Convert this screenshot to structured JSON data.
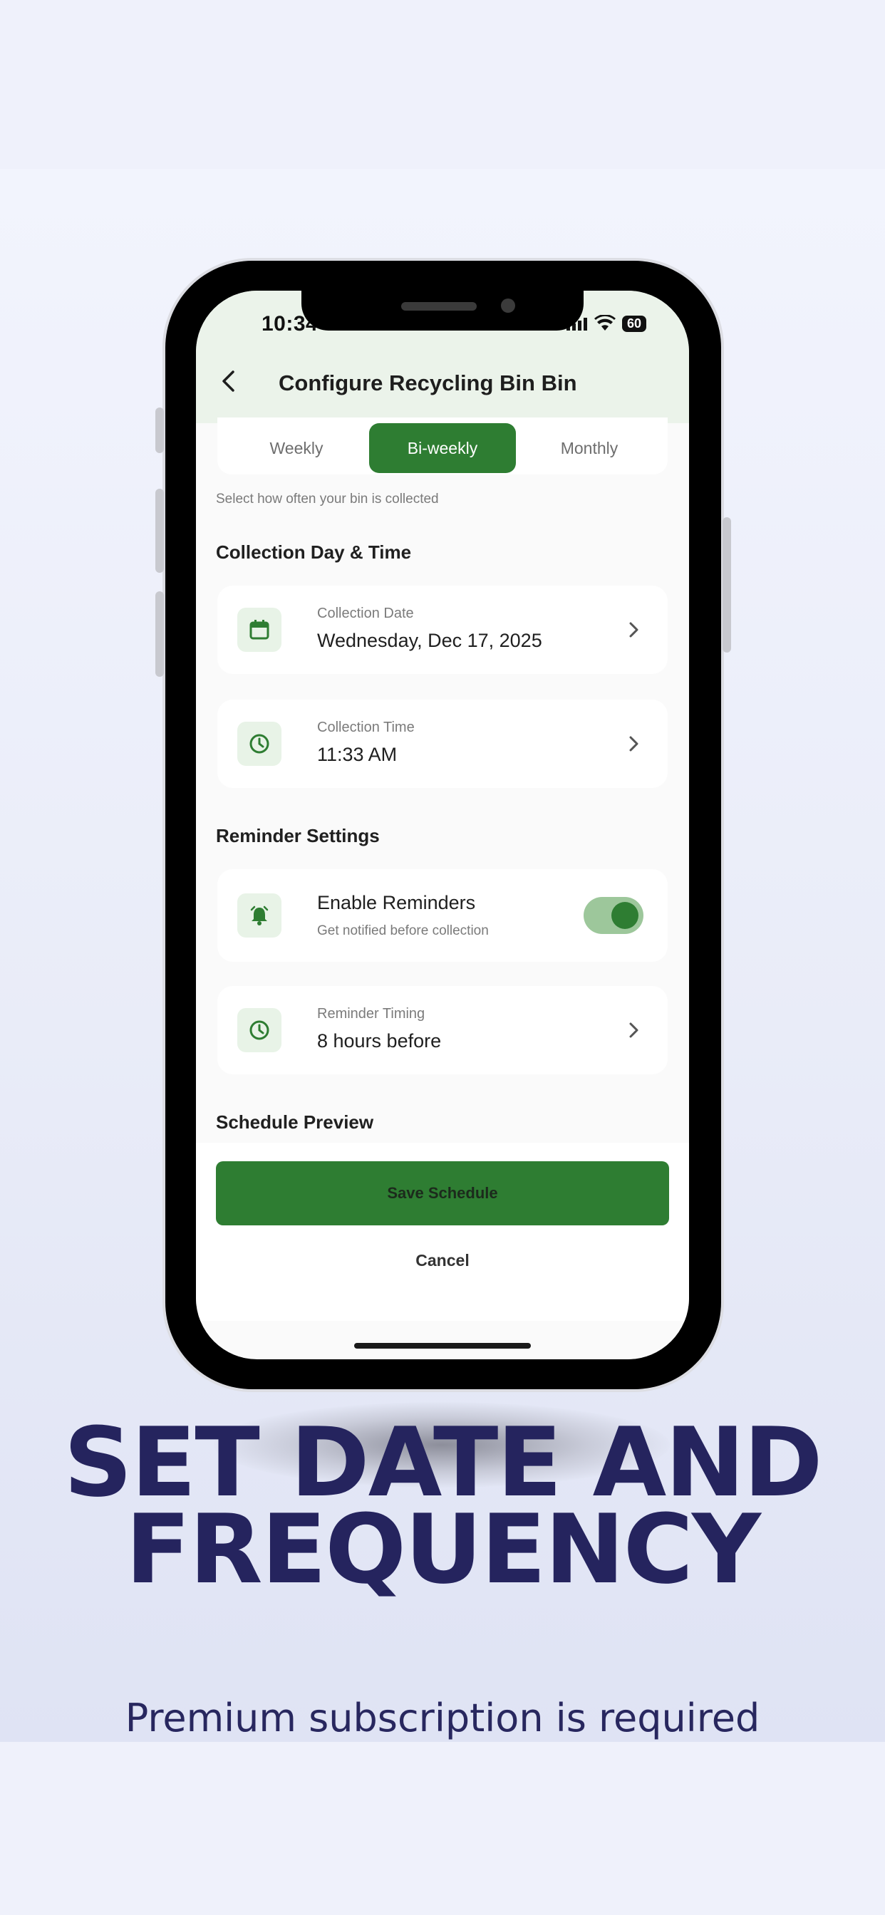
{
  "status_bar": {
    "time": "10:34",
    "battery": "60"
  },
  "header": {
    "title": "Configure Recycling Bin Bin"
  },
  "frequency": {
    "tabs": [
      "Weekly",
      "Bi-weekly",
      "Monthly"
    ],
    "selected": "Bi-weekly",
    "hint": "Select how often your bin is collected"
  },
  "collection": {
    "section_title": "Collection Day & Time",
    "date_label": "Collection Date",
    "date_value": "Wednesday, Dec 17, 2025",
    "time_label": "Collection Time",
    "time_value": "11:33 AM"
  },
  "reminders": {
    "section_title": "Reminder Settings",
    "enable_label": "Enable Reminders",
    "enable_sub": "Get notified before collection",
    "enabled": true,
    "timing_label": "Reminder Timing",
    "timing_value": "8 hours before"
  },
  "preview": {
    "section_title": "Schedule Preview"
  },
  "actions": {
    "save": "Save Schedule",
    "cancel": "Cancel"
  },
  "marketing": {
    "headline_line1": "SET DATE AND",
    "headline_line2": "FREQUENCY",
    "subline": "Premium subscription is required"
  },
  "colors": {
    "accent": "#2e7d32",
    "headline": "#25245e",
    "header_bg": "#ebf3ea"
  }
}
